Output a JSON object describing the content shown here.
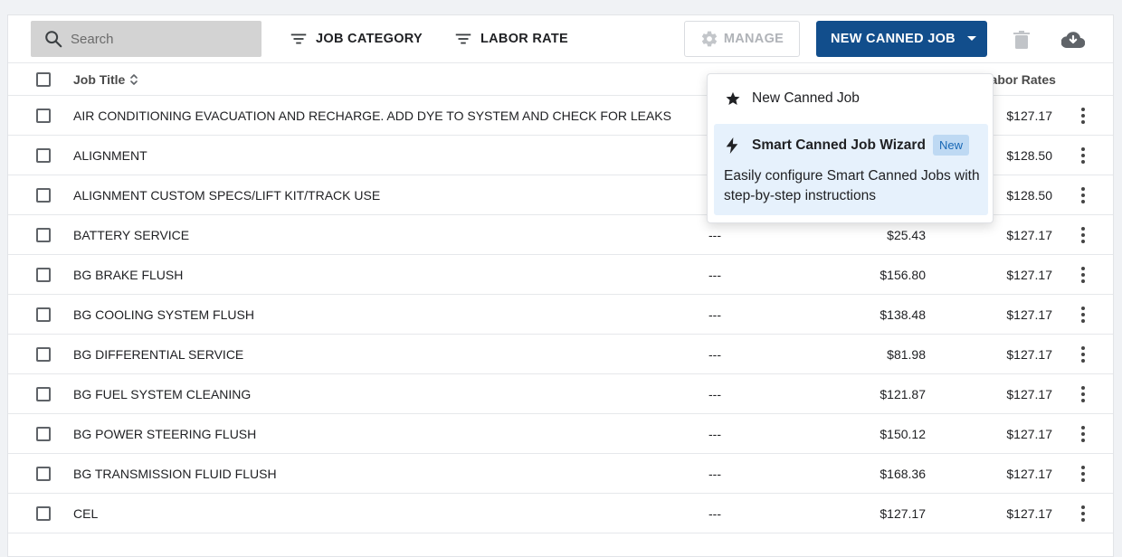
{
  "toolbar": {
    "search_placeholder": "Search",
    "filter_job_category": "JOB CATEGORY",
    "filter_labor_rate": "LABOR RATE",
    "manage_label": "MANAGE",
    "new_job_label": "NEW CANNED JOB"
  },
  "table": {
    "col_job_title": "Job Title",
    "col_labor_rates": "Labor Rates",
    "rows": [
      {
        "title": "AIR CONDITIONING EVACUATION AND RECHARGE. ADD DYE TO SYSTEM AND CHECK FOR LEAKS",
        "category": "",
        "price": "",
        "labor": "$127.17"
      },
      {
        "title": "ALIGNMENT",
        "category": "",
        "price": "",
        "labor": "$128.50"
      },
      {
        "title": "ALIGNMENT CUSTOM SPECS/LIFT KIT/TRACK USE",
        "category": "",
        "price": "",
        "labor": "$128.50"
      },
      {
        "title": "BATTERY SERVICE",
        "category": "---",
        "price": "$25.43",
        "labor": "$127.17"
      },
      {
        "title": "BG BRAKE FLUSH",
        "category": "---",
        "price": "$156.80",
        "labor": "$127.17"
      },
      {
        "title": "BG COOLING SYSTEM FLUSH",
        "category": "---",
        "price": "$138.48",
        "labor": "$127.17"
      },
      {
        "title": "BG DIFFERENTIAL SERVICE",
        "category": "---",
        "price": "$81.98",
        "labor": "$127.17"
      },
      {
        "title": "BG FUEL SYSTEM CLEANING",
        "category": "---",
        "price": "$121.87",
        "labor": "$127.17"
      },
      {
        "title": "BG POWER STEERING FLUSH",
        "category": "---",
        "price": "$150.12",
        "labor": "$127.17"
      },
      {
        "title": "BG TRANSMISSION FLUID FLUSH",
        "category": "---",
        "price": "$168.36",
        "labor": "$127.17"
      },
      {
        "title": "CEL",
        "category": "---",
        "price": "$127.17",
        "labor": "$127.17"
      }
    ]
  },
  "dropdown": {
    "item1_label": "New Canned Job",
    "item2_label": "Smart Canned Job Wizard",
    "item2_badge": "New",
    "item2_desc": "Easily configure Smart Canned Jobs with step-by-step instructions"
  }
}
